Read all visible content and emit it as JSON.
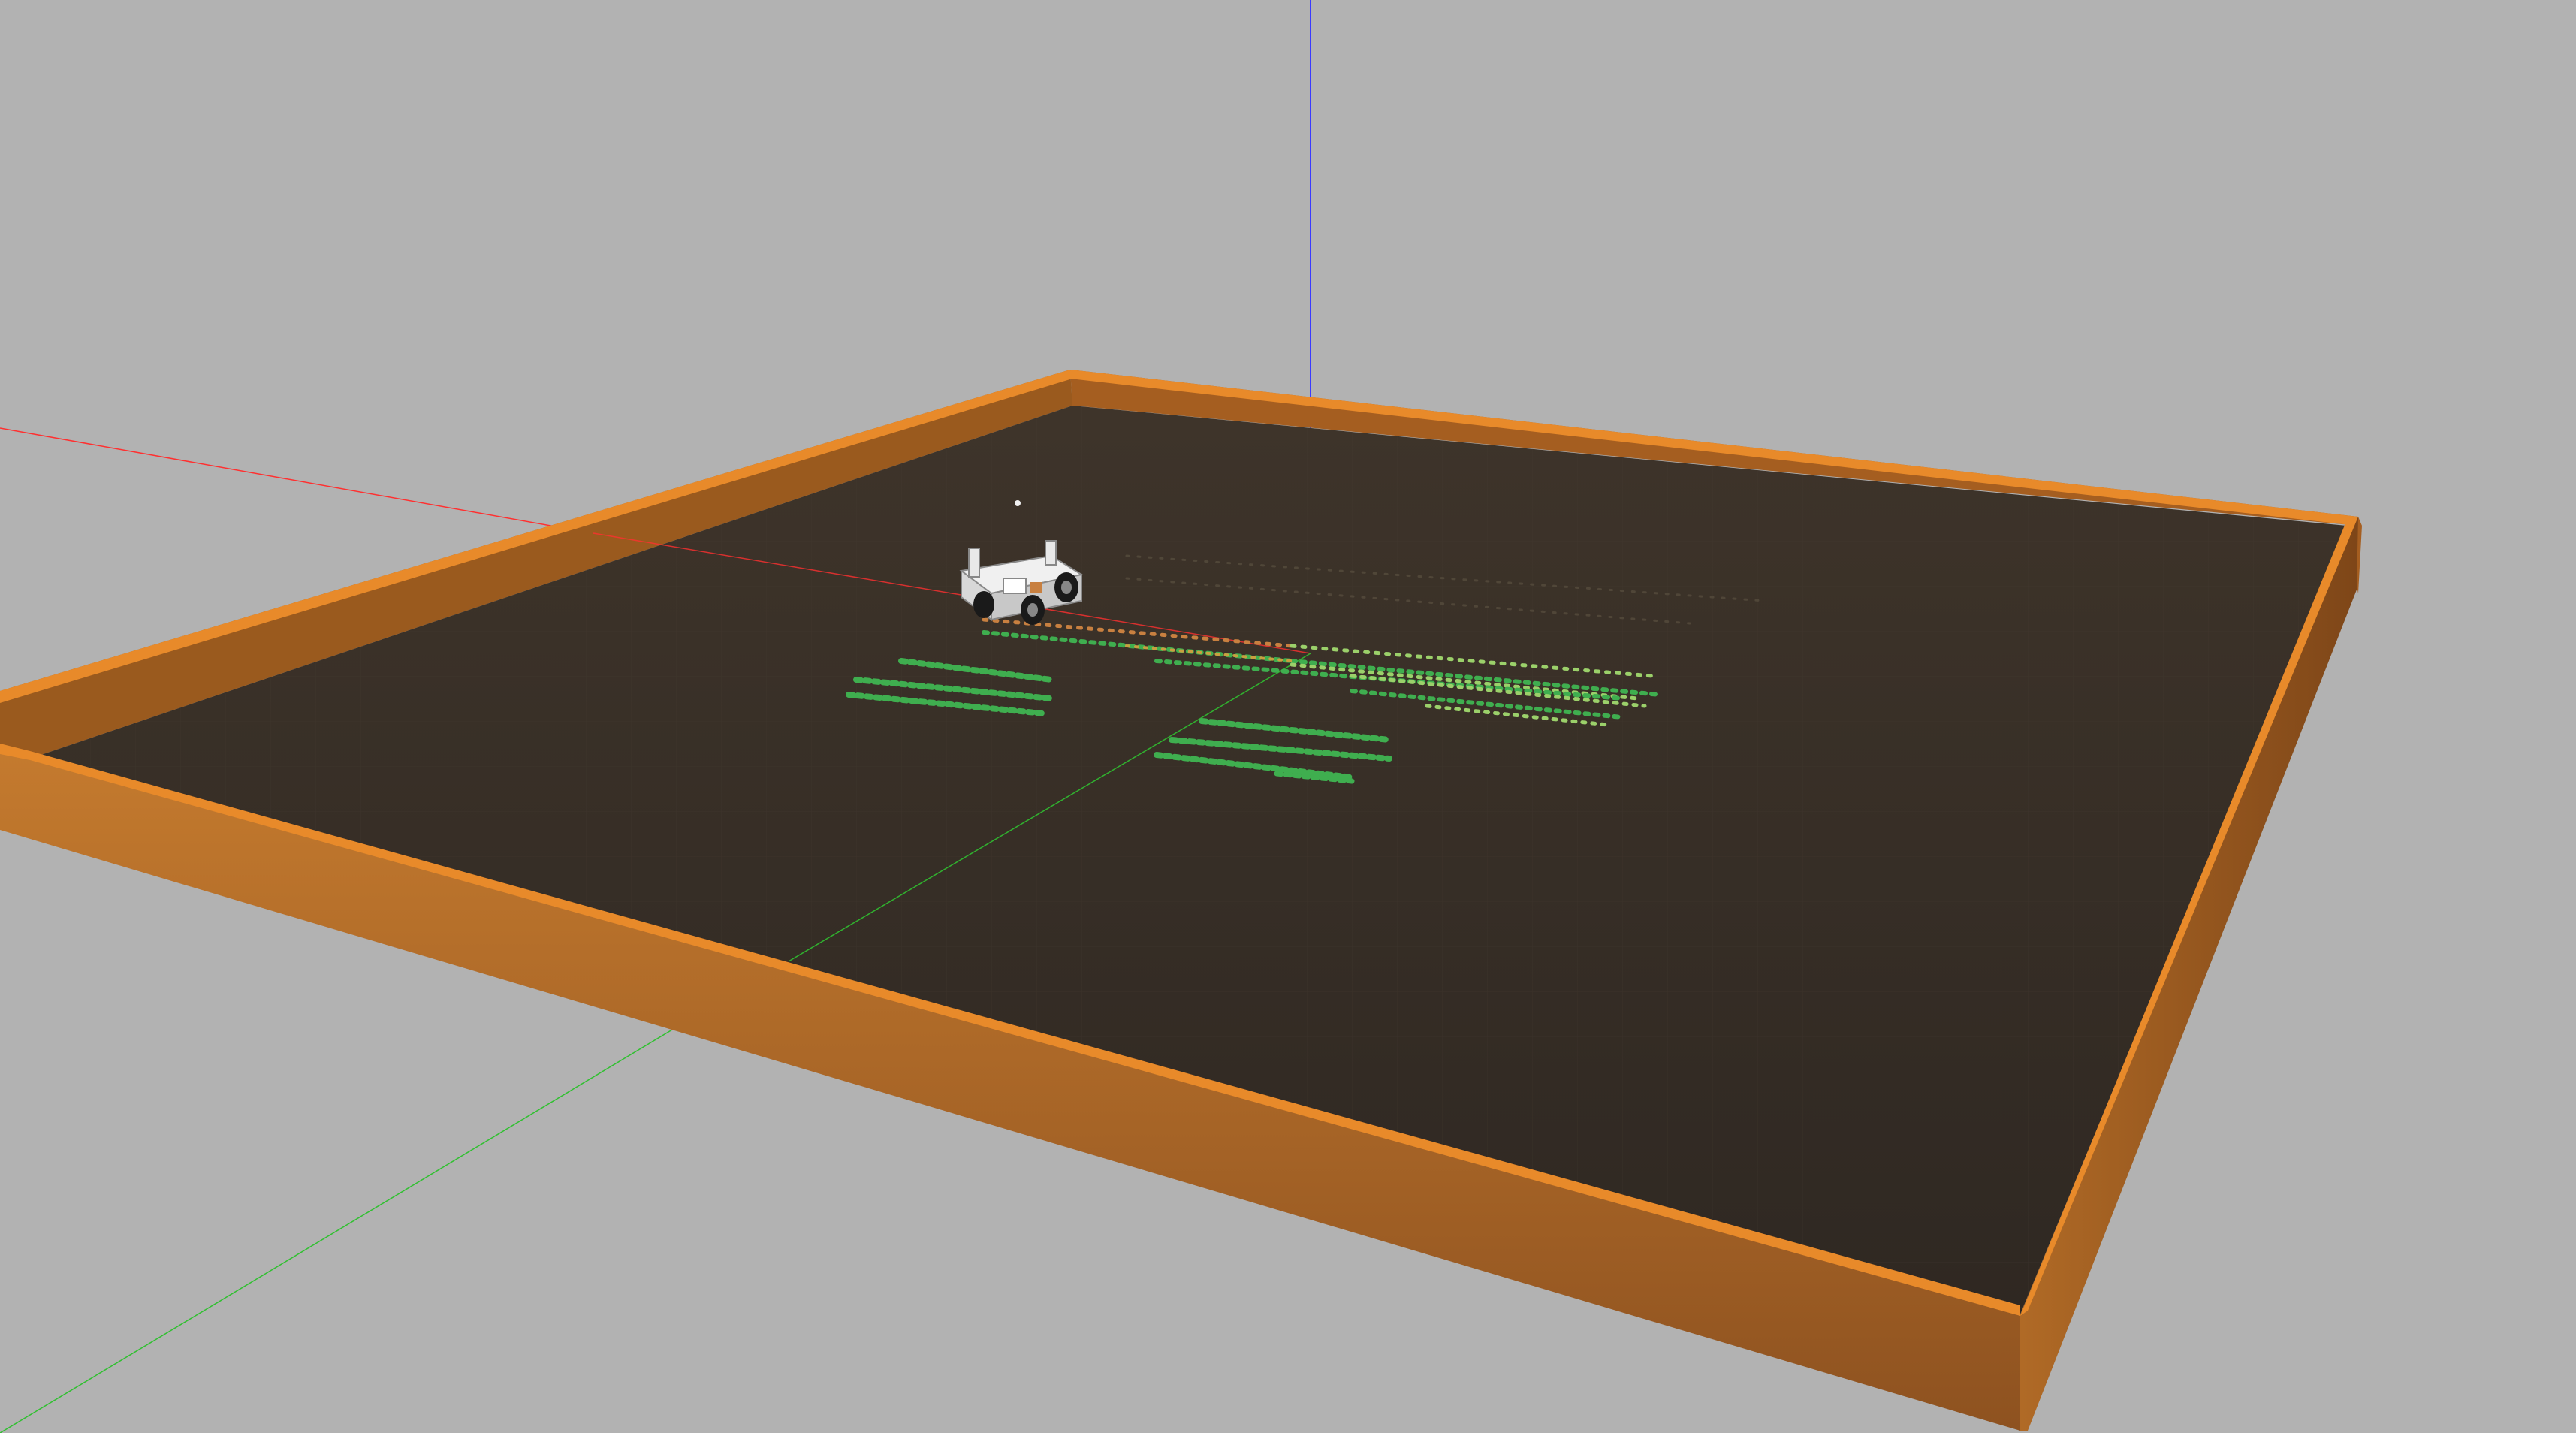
{
  "viewport": {
    "type": "3d-simulation-view",
    "background_color": "#b2b2b2"
  },
  "scene": {
    "ground_color": "#3a3128",
    "ground_grid_color": "#4a4036",
    "wall_color_top": "#e88a2a",
    "wall_color_face": "#b86a22",
    "wall_color_inner": "#8a4e1c",
    "axis_x_color": "#ff3030",
    "axis_y_color": "#30c030",
    "axis_z_color": "#3a3aff",
    "crop_color": "#3fae4f",
    "crop_color_young": "#9bd06a",
    "robot_body_color": "#e8e8e8",
    "robot_wheel_color": "#1a1a1a"
  },
  "icons": {
    "robot": "rover-robot-icon",
    "crops": "plant-row-icon"
  }
}
